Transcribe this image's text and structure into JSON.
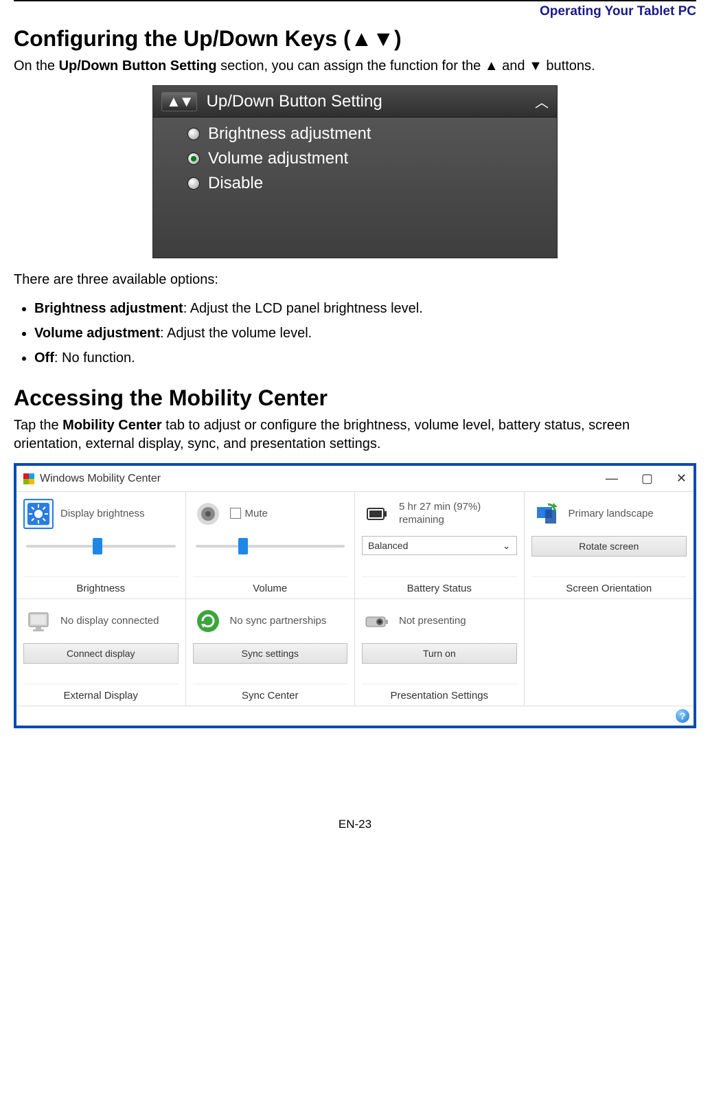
{
  "header": {
    "section": "Operating Your Tablet PC"
  },
  "s1": {
    "heading": "Configuring the Up/Down Keys (▲▼)",
    "p1a": "On the ",
    "p1b": "Up/Down Button Setting",
    "p1c": " section, you can assign the function for the ▲ and ▼ buttons.",
    "panel": {
      "title": "Up/Down Button Setting",
      "options": [
        "Brightness adjustment",
        "Volume adjustment",
        "Disable"
      ],
      "selected_index": 1
    },
    "p2": "There are three available options:",
    "bullets": [
      {
        "term": "Brightness adjustment",
        "desc": ": Adjust the LCD panel brightness level."
      },
      {
        "term": "Volume adjustment",
        "desc": ": Adjust the volume level."
      },
      {
        "term": "Off",
        "desc": ": No function."
      }
    ]
  },
  "s2": {
    "heading": "Accessing the Mobility Center",
    "p1a": "Tap the ",
    "p1b": "Mobility Center",
    "p1c": " tab to adjust or configure the brightness, volume level, battery status, screen orientation, external display, sync, and presentation settings."
  },
  "mc": {
    "title": "Windows Mobility Center",
    "brightness": {
      "label": "Display brightness",
      "caption": "Brightness",
      "value_pct": 48
    },
    "volume": {
      "mute_label": "Mute",
      "caption": "Volume",
      "value_pct": 32,
      "muted": false
    },
    "battery": {
      "status": "5 hr 27 min (97%) remaining",
      "plan": "Balanced",
      "caption": "Battery Status"
    },
    "orientation": {
      "status": "Primary landscape",
      "button": "Rotate screen",
      "caption": "Screen Orientation"
    },
    "external": {
      "status": "No display connected",
      "button": "Connect display",
      "caption": "External Display"
    },
    "sync": {
      "status": "No sync partnerships",
      "button": "Sync settings",
      "caption": "Sync Center"
    },
    "presentation": {
      "status": "Not presenting",
      "button": "Turn on",
      "caption": "Presentation Settings"
    }
  },
  "page_number": "EN-23"
}
